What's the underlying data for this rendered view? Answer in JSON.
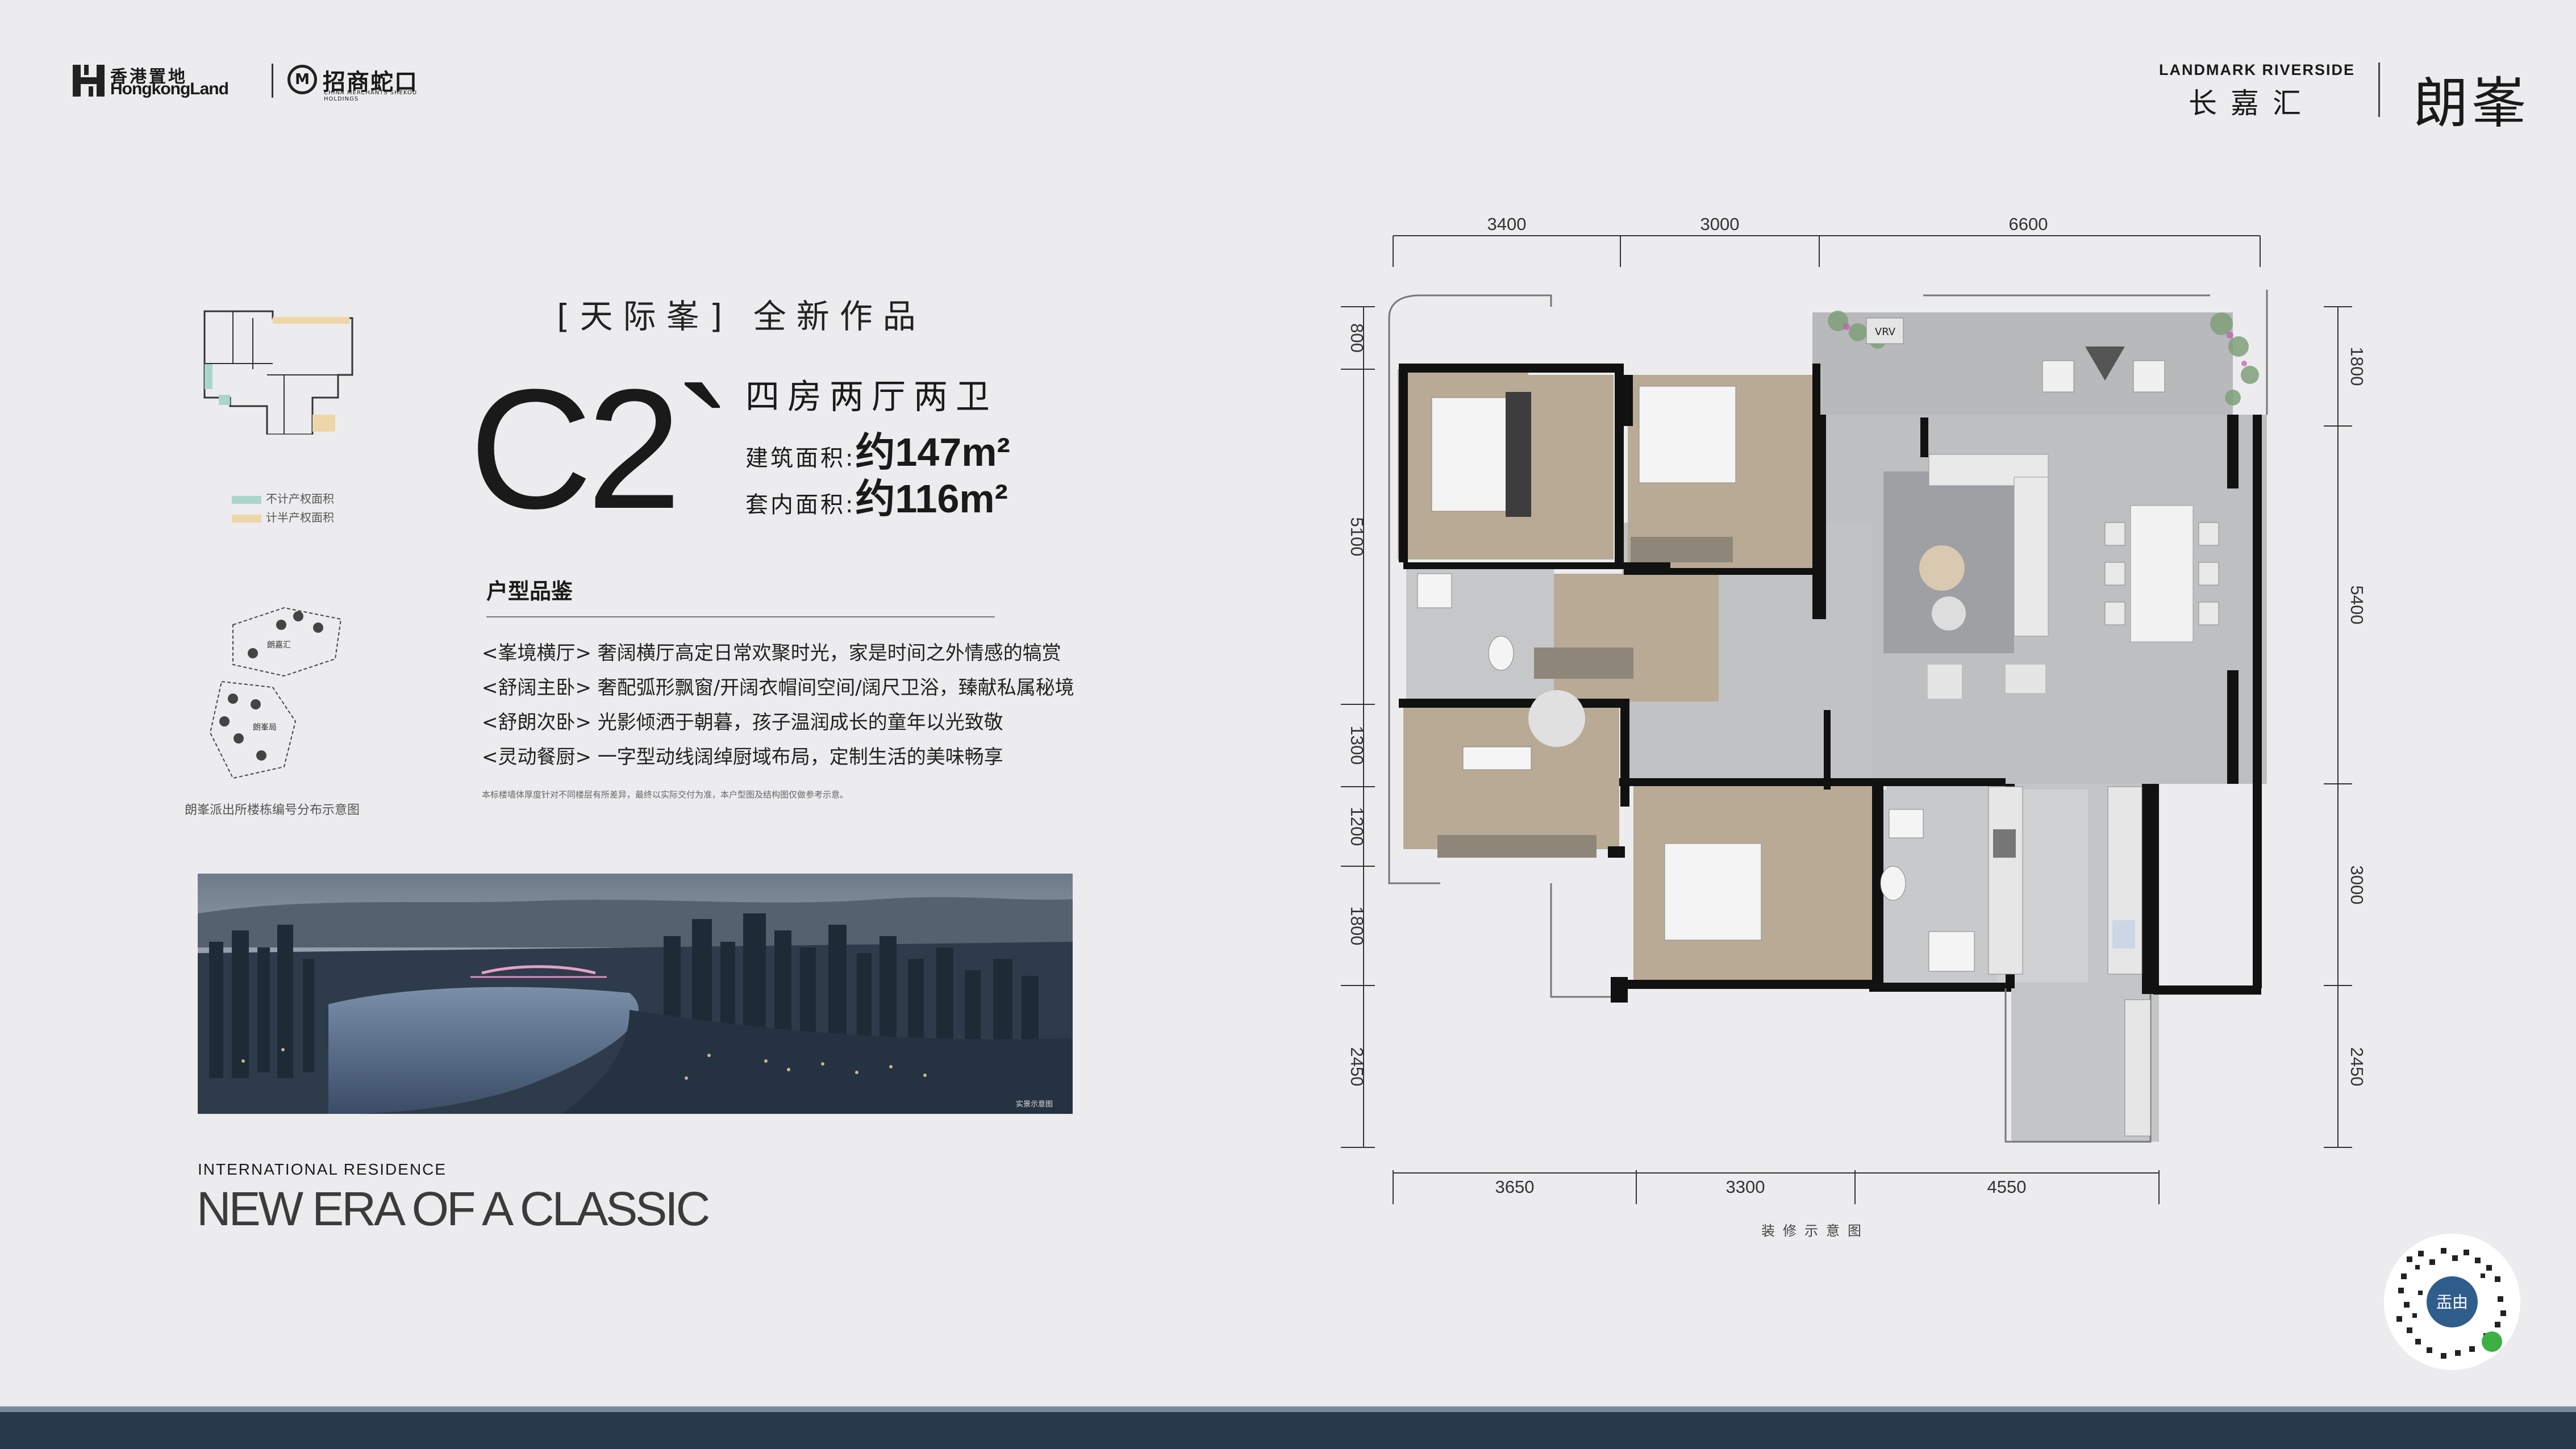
{
  "header": {
    "hongkong_land_cn": "香港置地",
    "hongkong_land_en": "HongkongLand",
    "cmsk_cn": "招商蛇口",
    "cmsk_en": "CHINA MERCHANTS SHEKOU HOLDINGS",
    "project_en": "LANDMARK RIVERSIDE",
    "project_cn": "长嘉汇",
    "project_name": "朗峯"
  },
  "unit": {
    "tagline": "[天际峯]  全新作品",
    "model": "C2`",
    "rooms": "四房两厅两卫",
    "built_area_label": "建筑面积:",
    "built_area_value": "约147m²",
    "inner_area_label": "套内面积:",
    "inner_area_value": "约116m²"
  },
  "features": {
    "title": "户型品鉴",
    "items": [
      "<峯境横厅> 奢阔横厅高定日常欢聚时光，家是时间之外情感的犒赏",
      "<舒阔主卧> 奢配弧形飘窗/开阔衣帽间空间/阔尺卫浴，臻献私属秘境",
      "<舒朗次卧> 光影倾洒于朝暮，孩子温润成长的童年以光致敬",
      "<灵动餐厨> 一字型动线阔绰厨域布局，定制生活的美味畅享"
    ],
    "note": "本标楼墙体厚度针对不同楼层有所差异，最终以实际交付为准，本户型图及结构图仅做参考示意。"
  },
  "legend": {
    "items": [
      {
        "label": "不计产权面积",
        "color": "#a9d6cb"
      },
      {
        "label": "计半产权面积",
        "color": "#efd6a8"
      }
    ]
  },
  "site_map": {
    "caption": "朗峯派出所楼栋编号分布示意图",
    "label_a": "朗嘉汇",
    "label_b": "朗峯局"
  },
  "photo": {
    "caption": "实景示意图"
  },
  "slogan": {
    "small": "INTERNATIONAL RESIDENCE",
    "large": "NEW ERA OF A CLASSIC"
  },
  "plan": {
    "top_dims": [
      "3400",
      "3000",
      "6600"
    ],
    "bottom_dims": [
      "3650",
      "3300",
      "4550"
    ],
    "left_dims": [
      "800",
      "5100",
      "1300",
      "1200",
      "1800",
      "2450"
    ],
    "right_dims": [
      "1800",
      "5400",
      "3000",
      "2450"
    ],
    "vrv_label": "VRV",
    "caption": "装修示意图"
  },
  "qr": {
    "center_label": "㿻由"
  }
}
